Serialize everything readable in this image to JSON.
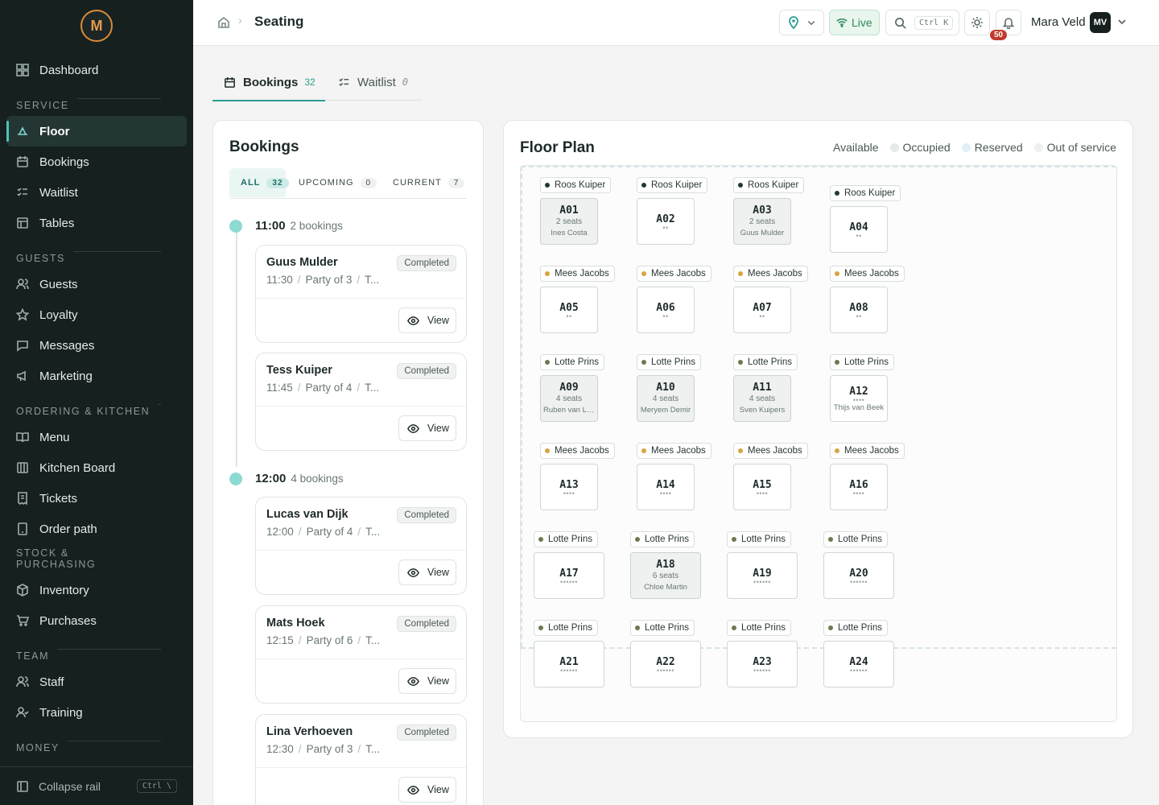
{
  "app": {
    "logo_text": "M",
    "brand_color": "#e89a4a"
  },
  "sidebar": {
    "top_item": {
      "label": "Dashboard"
    },
    "sections": [
      {
        "label": "SERVICE",
        "items": [
          {
            "label": "Floor",
            "active": true
          },
          {
            "label": "Bookings"
          },
          {
            "label": "Waitlist"
          },
          {
            "label": "Tables"
          }
        ]
      },
      {
        "label": "GUESTS",
        "items": [
          {
            "label": "Guests"
          },
          {
            "label": "Loyalty"
          },
          {
            "label": "Messages"
          },
          {
            "label": "Marketing"
          }
        ]
      },
      {
        "label": "ORDERING & KITCHEN",
        "items": [
          {
            "label": "Menu"
          },
          {
            "label": "Kitchen Board"
          },
          {
            "label": "Tickets"
          },
          {
            "label": "Order path"
          }
        ]
      },
      {
        "label": "STOCK & PURCHASING",
        "items": [
          {
            "label": "Inventory"
          },
          {
            "label": "Purchases"
          }
        ]
      },
      {
        "label": "TEAM",
        "items": [
          {
            "label": "Staff"
          },
          {
            "label": "Training"
          }
        ]
      },
      {
        "label": "MONEY",
        "items": []
      }
    ],
    "footer": {
      "label": "Collapse rail",
      "shortcut": "Ctrl \\"
    }
  },
  "header": {
    "title": "Seating",
    "live_label": "Live",
    "search_shortcut": "Ctrl K",
    "notification_count": "50",
    "user_name": "Mara Veld",
    "user_initials": "MV"
  },
  "tabs": [
    {
      "label": "Bookings",
      "count": "32"
    },
    {
      "label": "Waitlist",
      "count": "0"
    }
  ],
  "bookings": {
    "title": "Bookings",
    "filters": [
      {
        "label": "ALL",
        "count": "32"
      },
      {
        "label": "UPCOMING",
        "count": "0"
      },
      {
        "label": "CURRENT",
        "count": "7"
      }
    ],
    "groups": [
      {
        "time": "11:00",
        "count_label": "2 bookings",
        "items": [
          {
            "name": "Guus Mulder",
            "time": "11:30",
            "party": "Party of 3",
            "extra": "T...",
            "status": "Completed",
            "action": "View"
          },
          {
            "name": "Tess Kuiper",
            "time": "11:45",
            "party": "Party of 4",
            "extra": "T...",
            "status": "Completed",
            "action": "View"
          }
        ]
      },
      {
        "time": "12:00",
        "count_label": "4 bookings",
        "items": [
          {
            "name": "Lucas van Dijk",
            "time": "12:00",
            "party": "Party of 4",
            "extra": "T...",
            "status": "Completed",
            "action": "View"
          },
          {
            "name": "Mats Hoek",
            "time": "12:15",
            "party": "Party of 6",
            "extra": "T...",
            "status": "Completed",
            "action": "View"
          },
          {
            "name": "Lina Verhoeven",
            "time": "12:30",
            "party": "Party of 3",
            "extra": "T...",
            "status": "Completed",
            "action": "View"
          }
        ]
      }
    ]
  },
  "floor": {
    "title": "Floor Plan",
    "legend": [
      {
        "label": "Available",
        "color": "#ffffff"
      },
      {
        "label": "Occupied",
        "color": "#e6ebea"
      },
      {
        "label": "Reserved",
        "color": "#dff1f5"
      },
      {
        "label": "Out of service",
        "color": "#eef0ef"
      }
    ],
    "server_colors": {
      "Roos Kuiper": "#1f3a3a",
      "Mees Jacobs": "#d9a441",
      "Lotte Prins": "#6b7a4e"
    },
    "tables": [
      {
        "id": "A01",
        "server": "Roos Kuiper",
        "status": "occupied",
        "seats_label": "2 seats",
        "guest": "Ines Costa"
      },
      {
        "id": "A02",
        "server": "Roos Kuiper",
        "status": "available",
        "dots": "••"
      },
      {
        "id": "A03",
        "server": "Roos Kuiper",
        "status": "occupied",
        "seats_label": "2 seats",
        "guest": "Guus Mulder"
      },
      {
        "id": "A04",
        "server": "Roos Kuiper",
        "status": "available",
        "dots": "••"
      },
      {
        "id": "A05",
        "server": "Mees Jacobs",
        "status": "available",
        "dots": "••"
      },
      {
        "id": "A06",
        "server": "Mees Jacobs",
        "status": "available",
        "dots": "••"
      },
      {
        "id": "A07",
        "server": "Mees Jacobs",
        "status": "available",
        "dots": "••"
      },
      {
        "id": "A08",
        "server": "Mees Jacobs",
        "status": "available",
        "dots": "••"
      },
      {
        "id": "A09",
        "server": "Lotte Prins",
        "status": "occupied",
        "seats_label": "4 seats",
        "guest": "Ruben van Le..."
      },
      {
        "id": "A10",
        "server": "Lotte Prins",
        "status": "occupied",
        "seats_label": "4 seats",
        "guest": "Meryem Demir"
      },
      {
        "id": "A11",
        "server": "Lotte Prins",
        "status": "occupied",
        "seats_label": "4 seats",
        "guest": "Sven Kuipers"
      },
      {
        "id": "A12",
        "server": "Lotte Prins",
        "status": "reserved",
        "dots": "••••",
        "guest": "Thijs van Beek"
      },
      {
        "id": "A13",
        "server": "Mees Jacobs",
        "status": "available",
        "dots": "••••"
      },
      {
        "id": "A14",
        "server": "Mees Jacobs",
        "status": "available",
        "dots": "••••"
      },
      {
        "id": "A15",
        "server": "Mees Jacobs",
        "status": "available",
        "dots": "••••"
      },
      {
        "id": "A16",
        "server": "Mees Jacobs",
        "status": "available",
        "dots": "••••"
      },
      {
        "id": "A17",
        "server": "Lotte Prins",
        "status": "available",
        "dots": "••••••"
      },
      {
        "id": "A18",
        "server": "Lotte Prins",
        "status": "occupied",
        "seats_label": "6 seats",
        "guest": "Chloe Martin"
      },
      {
        "id": "A19",
        "server": "Lotte Prins",
        "status": "available",
        "dots": "••••••"
      },
      {
        "id": "A20",
        "server": "Lotte Prins",
        "status": "available",
        "dots": "••••••"
      },
      {
        "id": "A21",
        "server": "Lotte Prins",
        "status": "available",
        "dots": "••••••"
      },
      {
        "id": "A22",
        "server": "Lotte Prins",
        "status": "available",
        "dots": "••••••"
      },
      {
        "id": "A23",
        "server": "Lotte Prins",
        "status": "available",
        "dots": "••••••"
      },
      {
        "id": "A24",
        "server": "Lotte Prins",
        "status": "available",
        "dots": "••••••"
      }
    ]
  }
}
